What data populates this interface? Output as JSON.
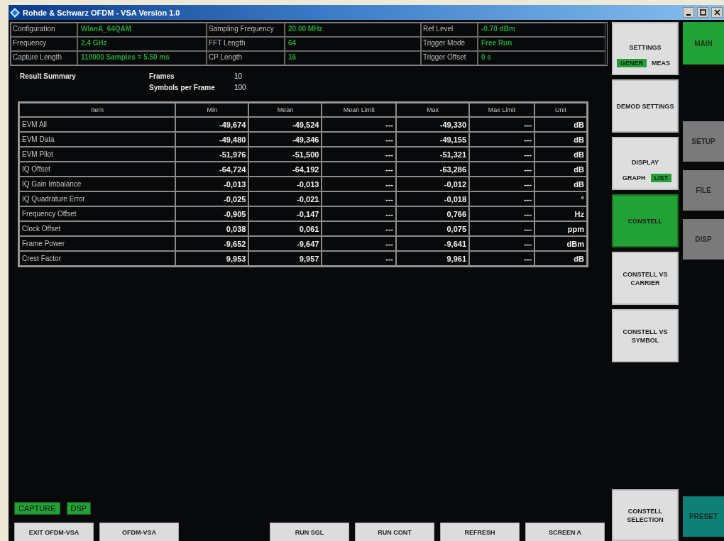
{
  "window": {
    "title": "Rohde & Schwarz OFDM - VSA Version 1.0"
  },
  "info": [
    {
      "label": "Configuration",
      "value": "WlanA_64QAM"
    },
    {
      "label": "Sampling Frequency",
      "value": "20.00 MHz"
    },
    {
      "label": "Ref Level",
      "value": "-0.70 dBm"
    },
    {
      "label": "Frequency",
      "value": "2.4 GHz"
    },
    {
      "label": "FFT Length",
      "value": "64"
    },
    {
      "label": "Trigger Mode",
      "value": "Free Run"
    },
    {
      "label": "Capture Length",
      "value": "110000 Samples = 5.50 ms"
    },
    {
      "label": "CP Length",
      "value": "16"
    },
    {
      "label": "Trigger Offset",
      "value": "0 s"
    }
  ],
  "summary": {
    "title": "Result Summary",
    "stats": [
      {
        "label": "Frames",
        "value": "10"
      },
      {
        "label": "Symbols per Frame",
        "value": "100"
      }
    ]
  },
  "table": {
    "columns": [
      "Item",
      "Min",
      "Mean",
      "Mean Limit",
      "Max",
      "Max Limit",
      "Unit"
    ],
    "rows": [
      [
        "EVM All",
        "-49,674",
        "-49,524",
        "---",
        "-49,330",
        "---",
        "dB"
      ],
      [
        "EVM Data",
        "-49,480",
        "-49,346",
        "---",
        "-49,155",
        "---",
        "dB"
      ],
      [
        "EVM Pilot",
        "-51,976",
        "-51,500",
        "---",
        "-51,321",
        "---",
        "dB"
      ],
      [
        "IQ Offset",
        "-64,724",
        "-64,192",
        "---",
        "-63,286",
        "---",
        "dB"
      ],
      [
        "IQ Gain Imbalance",
        "-0,013",
        "-0,013",
        "---",
        "-0,012",
        "---",
        "dB"
      ],
      [
        "IQ Quadrature Error",
        "-0,025",
        "-0,021",
        "---",
        "-0,018",
        "---",
        "°"
      ],
      [
        "Frequency Offset",
        "-0,905",
        "-0,147",
        "---",
        "0,766",
        "---",
        "Hz"
      ],
      [
        "Clock Offset",
        "0,038",
        "0,061",
        "---",
        "0,075",
        "---",
        "ppm"
      ],
      [
        "Frame Power",
        "-9,652",
        "-9,647",
        "---",
        "-9,641",
        "---",
        "dBm"
      ],
      [
        "Crest Factor",
        "9,953",
        "9,957",
        "---",
        "9,961",
        "---",
        "dB"
      ]
    ]
  },
  "indicators": [
    {
      "label": "CAPTURE",
      "on": true
    },
    {
      "label": "DSP",
      "on": true
    }
  ],
  "bottom_buttons_left": [
    "EXIT OFDM-VSA",
    "OFDM-VSA"
  ],
  "bottom_buttons_right": [
    "RUN SGL",
    "RUN CONT",
    "REFRESH",
    "SCREEN A"
  ],
  "softkeys": [
    {
      "kind": "toggle",
      "label": "SETTINGS",
      "selected": false,
      "options": [
        {
          "label": "GENER",
          "selected": true
        },
        {
          "label": "MEAS",
          "selected": false
        }
      ]
    },
    {
      "kind": "plain",
      "label": "DEMOD SETTINGS",
      "selected": false
    },
    {
      "kind": "toggle",
      "label": "DISPLAY",
      "selected": false,
      "options": [
        {
          "label": "GRAPH",
          "selected": false
        },
        {
          "label": "LIST",
          "selected": true
        }
      ]
    },
    {
      "kind": "plain",
      "label": "CONSTELL",
      "selected": true
    },
    {
      "kind": "plain",
      "label": "CONSTELL VS CARRIER",
      "selected": false
    },
    {
      "kind": "plain",
      "label": "CONSTELL VS SYMBOL",
      "selected": false
    },
    {
      "kind": "bottom",
      "label": "CONSTELL SELECTION",
      "selected": false
    }
  ],
  "menu_keys": [
    {
      "kind": "top",
      "label": "MAIN",
      "selected": true
    },
    {
      "kind": "menu",
      "label": "SETUP",
      "selected": false
    },
    {
      "kind": "menu",
      "label": "FILE",
      "selected": false
    },
    {
      "kind": "menu",
      "label": "DISP",
      "selected": false
    }
  ],
  "preset_key": {
    "label": "PRESET"
  }
}
